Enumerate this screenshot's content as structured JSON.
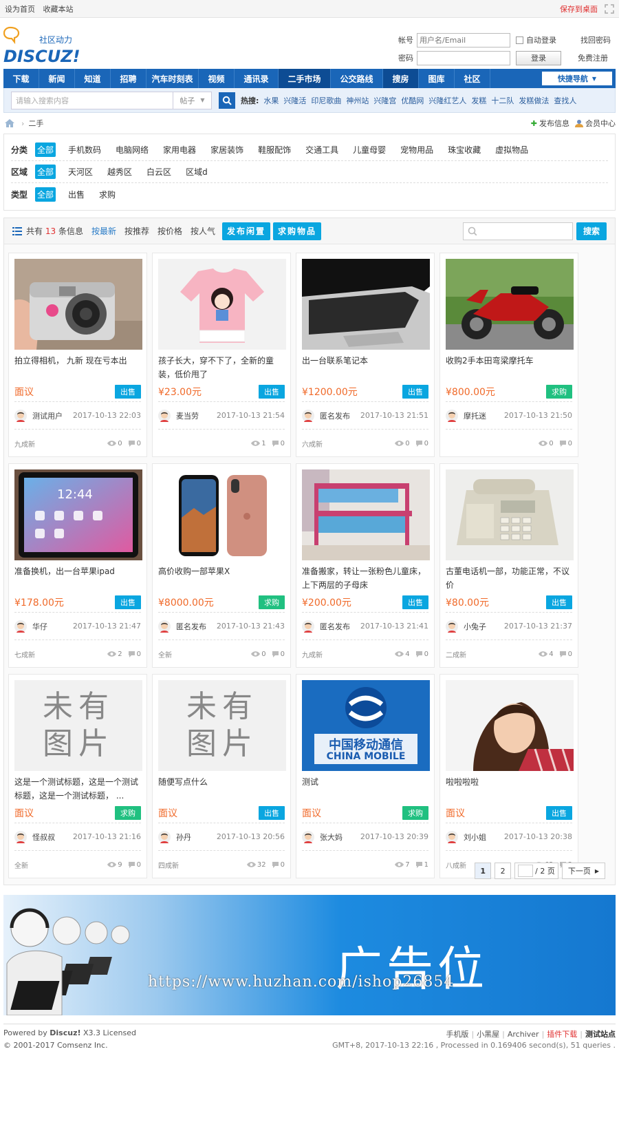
{
  "topbar": {
    "links": [
      "设为首页",
      "收藏本站"
    ],
    "save": "保存到桌面"
  },
  "logo": {
    "tagline": "社区动力",
    "brand": "DISCUZ!"
  },
  "login": {
    "account_label": "帐号",
    "account_placeholder": "用户名/Email",
    "auto_login": "自动登录",
    "find_password": "找回密码",
    "password_label": "密码",
    "login_button": "登录",
    "register": "免费注册"
  },
  "nav": {
    "items": [
      "下载",
      "新闻",
      "知道",
      "招聘",
      "汽车时刻表",
      "视频",
      "通讯录",
      "二手市场",
      "公交路线",
      "搜房",
      "图库",
      "社区"
    ],
    "active_index": 7,
    "quick": "快捷导航"
  },
  "search": {
    "placeholder": "请输入搜索内容",
    "type": "帖子",
    "hot_label": "热搜:",
    "hot": [
      "水果",
      "兴隆活",
      "印尼歌曲",
      "神州站",
      "兴隆宫",
      "优酷网",
      "兴隆红艺人",
      "发糕",
      "十二队",
      "发糕做法",
      "查找人"
    ]
  },
  "breadcrumb": {
    "current": "二手",
    "publish": "发布信息",
    "member": "会员中心"
  },
  "filters": {
    "category": {
      "label": "分类",
      "options": [
        "全部",
        "手机数码",
        "电脑网络",
        "家用电器",
        "家居装饰",
        "鞋服配饰",
        "交通工具",
        "儿童母婴",
        "宠物用品",
        "珠宝收藏",
        "虚拟物品"
      ]
    },
    "region": {
      "label": "区域",
      "options": [
        "全部",
        "天河区",
        "越秀区",
        "白云区",
        "区域d"
      ]
    },
    "type": {
      "label": "类型",
      "options": [
        "全部",
        "出售",
        "求购"
      ]
    }
  },
  "toolbar": {
    "sum_prefix": "共有",
    "count": "13",
    "sum_suffix": "条信息",
    "sorts": [
      "按最新",
      "按推荐",
      "按价格",
      "按人气"
    ],
    "publish_idle": "发布闲置",
    "buy_request": "求购物品",
    "search_button": "搜索"
  },
  "items": [
    {
      "title": "拍立得相机， 九新 现在亏本出",
      "price": "面议",
      "tag": "出售",
      "kind": "sell",
      "user": "测试用户",
      "time": "2017-10-13 22:03",
      "cond": "九成新",
      "views": "0",
      "replies": "0",
      "img": "camera"
    },
    {
      "title": "孩子长大，穿不下了，全新的童装，低价甩了",
      "price": "¥23.00元",
      "tag": "出售",
      "kind": "sell",
      "user": "麦当劳",
      "time": "2017-10-13 21:54",
      "cond": "",
      "views": "1",
      "replies": "0",
      "img": "shirt"
    },
    {
      "title": "出一台联系笔记本",
      "price": "¥1200.00元",
      "tag": "出售",
      "kind": "sell",
      "user": "匿名发布",
      "time": "2017-10-13 21:51",
      "cond": "六成新",
      "views": "0",
      "replies": "0",
      "img": "laptop"
    },
    {
      "title": "收购2手本田弯梁摩托车",
      "price": "¥800.00元",
      "tag": "求购",
      "kind": "buy",
      "user": "摩托迷",
      "time": "2017-10-13 21:50",
      "cond": "",
      "views": "0",
      "replies": "0",
      "img": "moto"
    },
    {
      "title": "准备换机，出一台苹果ipad",
      "price": "¥178.00元",
      "tag": "出售",
      "kind": "sell",
      "user": "华仔",
      "time": "2017-10-13 21:47",
      "cond": "七成新",
      "views": "2",
      "replies": "0",
      "img": "ipad"
    },
    {
      "title": "高价收购一部苹果X",
      "price": "¥8000.00元",
      "tag": "求购",
      "kind": "buy",
      "user": "匿名发布",
      "time": "2017-10-13 21:43",
      "cond": "全新",
      "views": "0",
      "replies": "0",
      "img": "iphone"
    },
    {
      "title": "准备搬家，转让一张粉色儿童床，上下两层的子母床",
      "price": "¥200.00元",
      "tag": "出售",
      "kind": "sell",
      "user": "匿名发布",
      "time": "2017-10-13 21:41",
      "cond": "九成新",
      "views": "4",
      "replies": "0",
      "img": "bed"
    },
    {
      "title": "古董电话机一部，功能正常，不议价",
      "price": "¥80.00元",
      "tag": "出售",
      "kind": "sell",
      "user": "小兔子",
      "time": "2017-10-13 21:37",
      "cond": "二成新",
      "views": "4",
      "replies": "0",
      "img": "phone"
    },
    {
      "title": "这是一个测试标题，这是一个测试标题，这是一个测试标题， ...",
      "price": "面议",
      "tag": "求购",
      "kind": "buy",
      "user": "怪叔叔",
      "time": "2017-10-13 21:16",
      "cond": "全新",
      "views": "9",
      "replies": "0",
      "img": "noimg"
    },
    {
      "title": "随便写点什么",
      "price": "面议",
      "tag": "出售",
      "kind": "sell",
      "user": "孙丹",
      "time": "2017-10-13 20:56",
      "cond": "四成新",
      "views": "32",
      "replies": "0",
      "img": "noimg"
    },
    {
      "title": "测试",
      "price": "面议",
      "tag": "求购",
      "kind": "buy",
      "user": "张大妈",
      "time": "2017-10-13 20:39",
      "cond": "",
      "views": "7",
      "replies": "1",
      "img": "mobile"
    },
    {
      "title": "啦啦啦啦",
      "price": "面议",
      "tag": "出售",
      "kind": "sell",
      "user": "刘小姐",
      "time": "2017-10-13 20:38",
      "cond": "八成新",
      "views": "62",
      "replies": "3",
      "img": "girl"
    }
  ],
  "noimg_text": [
    "未有",
    "图片"
  ],
  "mobile_logo": {
    "cn": "中国移动通信",
    "en": "CHINA MOBILE"
  },
  "pager": {
    "pages": [
      "1",
      "2"
    ],
    "current": "1",
    "total": "/ 2 页",
    "next": "下一页"
  },
  "banner": {
    "text": "广告位",
    "watermark": "https://www.huzhan.com/ishop26854"
  },
  "footer": {
    "powered_prefix": "Powered by",
    "powered_brand": "Discuz!",
    "powered_suffix": "X3.3 Licensed",
    "copyright": "© 2001-2017 Comsenz Inc.",
    "links": [
      "手机版",
      "小黑屋",
      "Archiver",
      "插件下载",
      "测试站点"
    ],
    "stats": "GMT+8, 2017-10-13 22:16 , Processed in 0.169406 second(s), 51 queries ."
  },
  "colors": {
    "nav": "#1a66b8",
    "accent": "#0aa6e0",
    "buy": "#20c080",
    "price": "#f06a2a",
    "red": "#e03030"
  }
}
